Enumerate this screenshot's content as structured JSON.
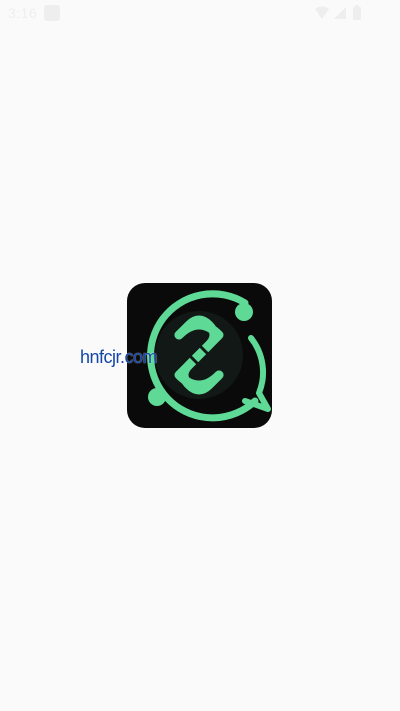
{
  "status_bar": {
    "time": "3:16"
  },
  "splash": {
    "logo": "chat-knot-logo-icon",
    "colors": {
      "background": "#0a0a0a",
      "accent": "#5fd996"
    }
  },
  "watermark": {
    "text": "hnfcjr.com"
  }
}
